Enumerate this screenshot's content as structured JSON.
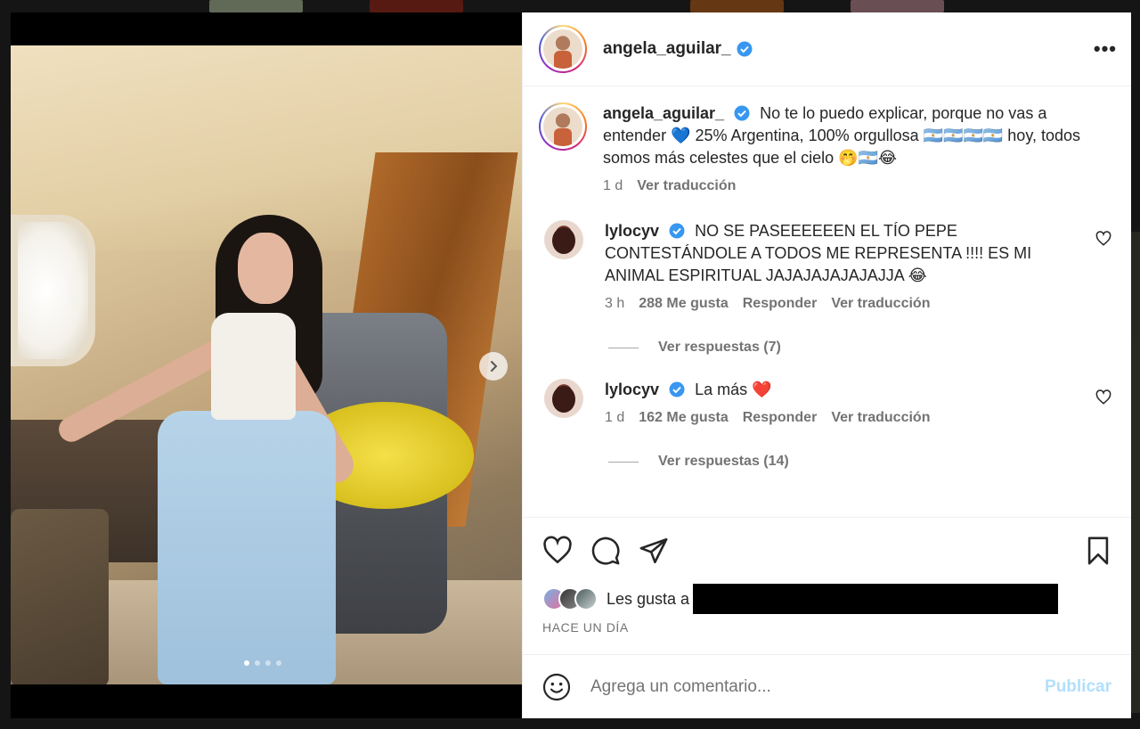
{
  "post": {
    "author": "angela_aguilar_",
    "caption_text": "No te lo puedo explicar, porque no vas a entender 💙 25% Argentina, 100% orgullosa 🇦🇷🇦🇷🇦🇷🇦🇷 hoy, todos somos más celestes que el cielo 🤭🇦🇷😂",
    "caption_time": "1 d",
    "caption_translate": "Ver traducción",
    "carousel": {
      "total": 4,
      "active": 1
    }
  },
  "comments": [
    {
      "user": "lylocyv",
      "text": "NO SE PASEEEEEEN EL TÍO PEPE CONTESTÁNDOLE A TODOS ME REPRESENTA !!!! ES MI ANIMAL ESPIRITUAL JAJAJAJAJAJAJJA 😂",
      "time": "3 h",
      "likes": "288 Me gusta",
      "reply": "Responder",
      "translate": "Ver traducción",
      "replies": "Ver respuestas (7)"
    },
    {
      "user": "lylocyv",
      "text": "La más ❤️",
      "time": "1 d",
      "likes": "162 Me gusta",
      "reply": "Responder",
      "translate": "Ver traducción",
      "replies": "Ver respuestas (14)"
    }
  ],
  "likes_prefix": "Les gusta a",
  "timestamp": "HACE UN DÍA",
  "composer": {
    "placeholder": "Agrega un comentario...",
    "publish": "Publicar"
  },
  "colors": {
    "verified": "#3897f0",
    "publish_disabled": "#b2dffc"
  }
}
